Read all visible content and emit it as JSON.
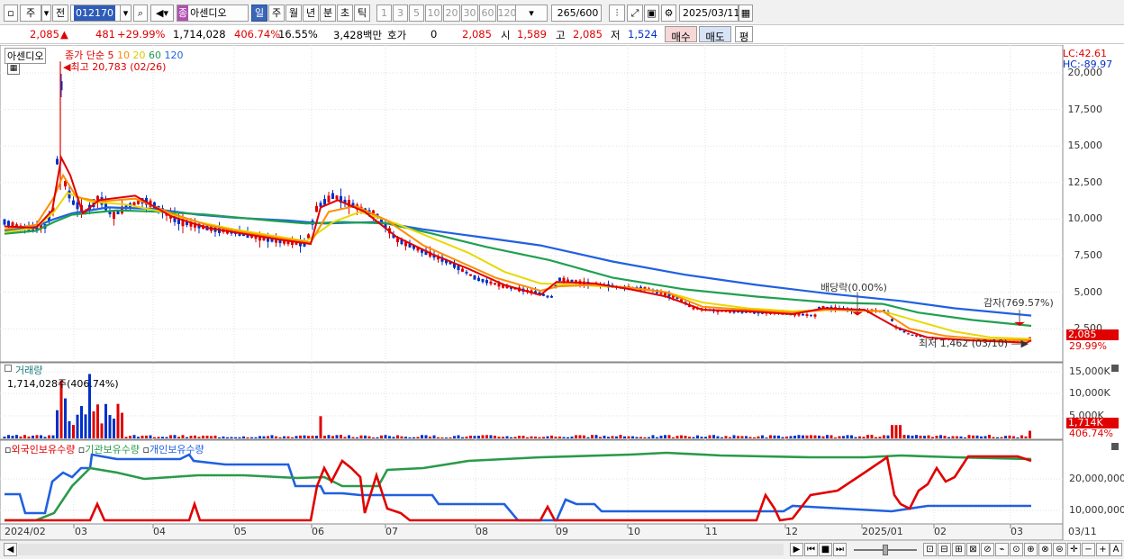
{
  "toolbar": {
    "period_type": "주",
    "prev_label": "전",
    "code": "012170",
    "name_badge": "종",
    "stock_name": "아센디오",
    "periods": [
      "일",
      "주",
      "월",
      "년",
      "분",
      "초",
      "틱"
    ],
    "active_period": "일",
    "intervals": [
      "1",
      "3",
      "5",
      "10",
      "20",
      "30",
      "60",
      "120"
    ],
    "count": "265",
    "count_total": "/600",
    "date": "2025/03/11"
  },
  "quote": {
    "price": "2,085",
    "change": "481",
    "change_pct": "+29.99%",
    "volume": "1,714,028",
    "volume_ratio": "406.74%",
    "turnover": "16.55%",
    "amount": "3,428백만",
    "hoga_label": "호가",
    "hoga": "0",
    "open_price": "2,085",
    "open_label": "시",
    "open": "1,589",
    "high_label": "고",
    "high": "2,085",
    "low_label": "저",
    "low": "1,524",
    "buy_label": "매수",
    "sell_label": "매도",
    "eval_label": "평"
  },
  "price_panel": {
    "name": "아센디오",
    "ma_label": "종가 단순",
    "ma_periods": [
      "5",
      "10",
      "20",
      "60",
      "120"
    ],
    "max_label": "최고 20,783 (02/26)",
    "min_label": "최저 1,462 (03/10)",
    "dividend_label": "배당락(0.00%)",
    "capital_label": "감자(769.57%)",
    "lc": "LC:42.61",
    "hc": "HC:-89.97",
    "yaxis": [
      "20,000",
      "17,500",
      "15,000",
      "12,500",
      "10,000",
      "7,500",
      "5,000",
      "2,500"
    ],
    "last_price_tag": "2,085",
    "last_pct_tag": "29.99%"
  },
  "volume_panel": {
    "title": "거래량",
    "value": "1,714,028주(406.74%)",
    "yaxis": [
      "15,000K",
      "10,000K",
      "5,000K"
    ],
    "last_tag": "1,714K",
    "last_pct": "406.74%"
  },
  "holding_panel": {
    "series": [
      "외국인보유수량",
      "기관보유수량",
      "개인보유수량"
    ],
    "yaxis": [
      "20,000,000",
      "10,000,000"
    ]
  },
  "xaxis": {
    "labels": [
      "2024/02",
      "03",
      "04",
      "05",
      "06",
      "07",
      "08",
      "09",
      "10",
      "11",
      "12",
      "2025/01",
      "02",
      "03",
      "03/11"
    ]
  },
  "colors": {
    "up": "#e00000",
    "down": "#0030c8",
    "ma5": "#e00000",
    "ma10": "#ff8c00",
    "ma20": "#e8d800",
    "ma60": "#20a050",
    "ma120": "#2060e0",
    "foreign": "#e00000",
    "institution": "#2a9a4a",
    "individual": "#2060e0"
  },
  "chart_data": {
    "type": "line",
    "title": "",
    "x": [
      "2024/02",
      "03",
      "04",
      "05",
      "06",
      "07",
      "08",
      "09",
      "10",
      "11",
      "12",
      "2025/01",
      "02",
      "03"
    ],
    "series": [
      {
        "name": "5",
        "values": [
          9500,
          11000,
          10500,
          9200,
          10800,
          9500,
          6500,
          5200,
          4300,
          3400,
          3600,
          3400,
          1800,
          1700
        ]
      },
      {
        "name": "120",
        "values": [
          9000,
          9600,
          9900,
          9800,
          9700,
          9600,
          9100,
          8300,
          7500,
          6500,
          5400,
          4500,
          3600,
          3100
        ]
      }
    ],
    "ylim": [
      0,
      20783
    ]
  }
}
